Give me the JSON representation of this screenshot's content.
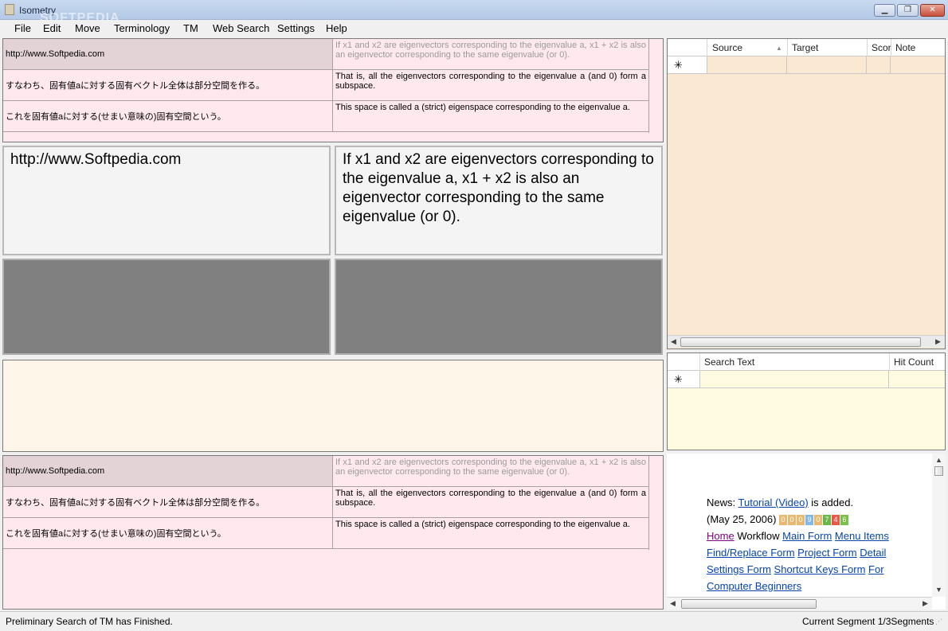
{
  "window": {
    "title": "Isometry",
    "watermark": "SOFTPEDIA"
  },
  "menu": [
    "File",
    "Edit",
    "Move",
    "Terminology",
    "TM",
    "Web Search",
    "Settings",
    "Help"
  ],
  "segments": [
    {
      "source": "http://www.Softpedia.com",
      "target": "If x1 and x2 are eigenvectors corresponding to the eigenvalue a, x1 + x2 is also an eigenvector corresponding to the same eigenvalue (or 0)."
    },
    {
      "source": "すなわち、固有値aに対する固有ベクトル全体は部分空間を作る。",
      "target": "That is, all the eigenvectors corresponding to the eigenvalue a (and 0) form a subspace."
    },
    {
      "source": "これを固有値aに対する(せまい意味の)固有空間という。",
      "target": "This space is called a (strict) eigenspace corresponding to the eigenvalue a."
    }
  ],
  "editor": {
    "source": "http://www.Softpedia.com",
    "target": "If x1 and x2 are eigenvectors corresponding to the eigenvalue a, x1 + x2 is also an eigenvector corresponding to the same eigenvalue (or 0)."
  },
  "tm_grid": {
    "columns": [
      "Source",
      "Target",
      "Scor",
      "Note"
    ],
    "new_row_marker": "✳"
  },
  "search_grid": {
    "columns": [
      "Search Text",
      "Hit Count"
    ],
    "new_row_marker": "✳"
  },
  "news": {
    "prefix": "News:",
    "tutorial_link": "Tutorial (Video)",
    "suffix": "is added.",
    "date": "(May 25, 2006)",
    "counter_digits": [
      "0",
      "0",
      "0",
      "9",
      "0",
      "7",
      "4",
      "6"
    ],
    "counter_colors": [
      "#e8b870",
      "#e8b870",
      "#e8b870",
      "#7fb8e6",
      "#e8b870",
      "#68b848",
      "#e85848",
      "#78c048"
    ],
    "home": "Home",
    "workflow": "Workflow",
    "links": [
      "Main Form",
      "Menu Items",
      "Find/Replace Form",
      "Project Form",
      "Detail Settings Form",
      "Shortcut Keys Form",
      "For Computer Beginners"
    ]
  },
  "status": {
    "left": "Preliminary Search of TM has Finished.",
    "right": "Current Segment 1/3Segments"
  },
  "colors": {
    "segment_bg": "#ffe9ef",
    "tm_bg": "#fbe8d2",
    "search_bg": "#fffbe0",
    "note_bg": "#fdf6e9",
    "gray_box": "#808080"
  }
}
